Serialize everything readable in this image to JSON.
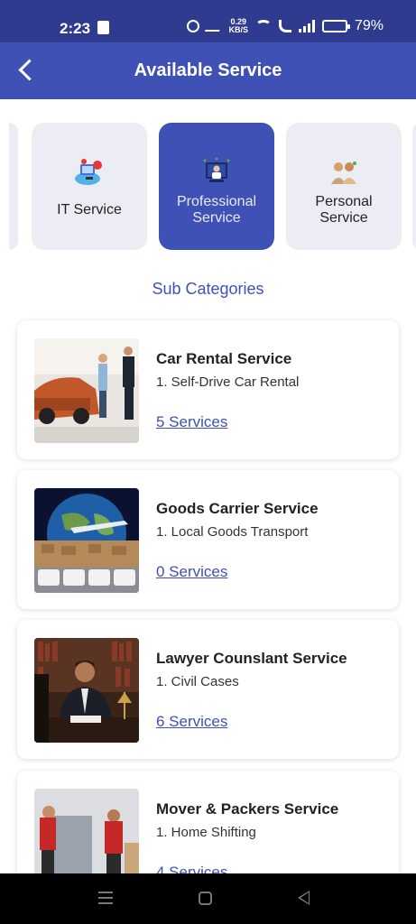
{
  "status_bar": {
    "time": "2:23",
    "net_speed_value": "0.29",
    "net_speed_unit": "KB/S",
    "battery_percent": "79%",
    "battery_level": 0.79
  },
  "app_bar": {
    "title": "Available Service",
    "back_icon": "back-arrow-icon"
  },
  "categories": [
    {
      "label": "IT Service",
      "icon": "it-service-icon",
      "selected": false
    },
    {
      "label": "Professional Service",
      "icon": "professional-service-icon",
      "selected": true
    },
    {
      "label": "Personal Service",
      "icon": "personal-service-icon",
      "selected": false
    }
  ],
  "sub_categories_heading": "Sub Categories",
  "services": [
    {
      "title": "Car Rental Service",
      "subtitle": "1. Self-Drive Car Rental",
      "link": "5 Services",
      "image": "car-rental-photo"
    },
    {
      "title": "Goods Carrier Service",
      "subtitle": "1. Local Goods Transport",
      "link": "0 Services",
      "image": "goods-carrier-photo"
    },
    {
      "title": "Lawyer Counslant Service",
      "subtitle": "1. Civil Cases",
      "link": "6 Services",
      "image": "lawyer-photo"
    },
    {
      "title": "Mover & Packers Service",
      "subtitle": "1. Home Shifting",
      "link": "4 Services",
      "image": "movers-photo"
    }
  ],
  "colors": {
    "status_bar": "#2f3b8f",
    "primary": "#3f51b5",
    "card_bg": "#ececf4",
    "battery": "#f2c12e"
  }
}
